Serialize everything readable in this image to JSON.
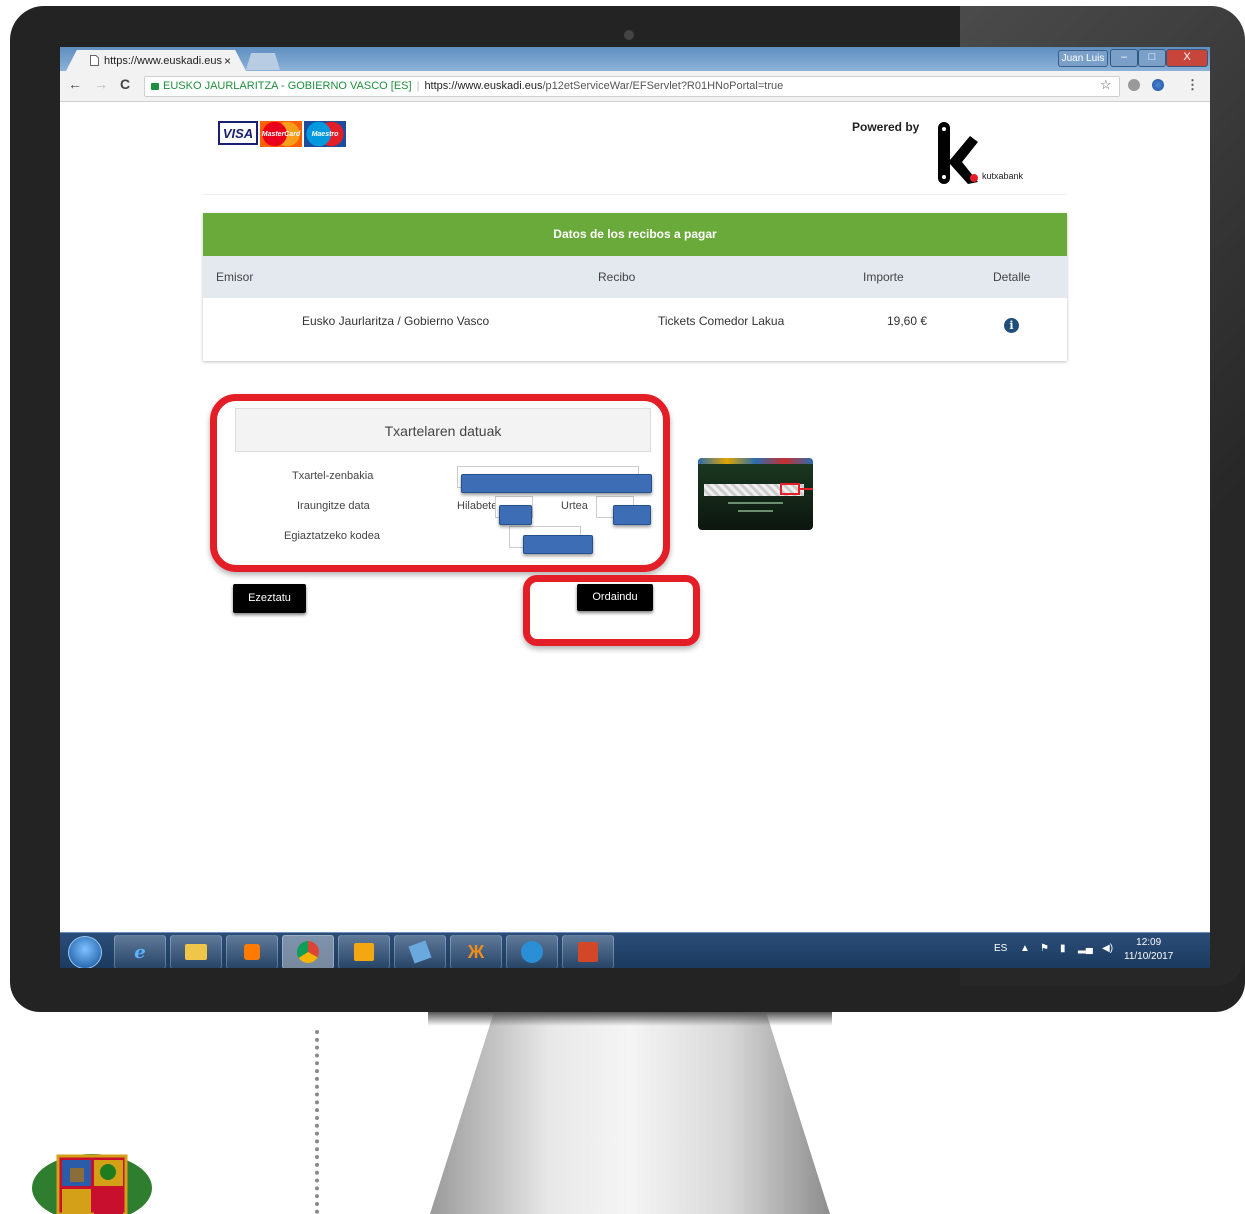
{
  "browser": {
    "tab_title": "https://www.euskadi.eus",
    "tab_close": "×",
    "window_user": "Juan Luis",
    "minimize": "–",
    "maximize": "□",
    "close": "X",
    "back": "←",
    "forward": "→",
    "reload": "C",
    "site_identity": "EUSKO JAURLARITZA - GOBIERNO VASCO [ES]",
    "url_host": "https://www.euskadi.eus",
    "url_path": "/p12etServiceWar/EFServlet?R01HNoPortal=true",
    "bookmark_star": "☆",
    "menu": "⋮"
  },
  "header": {
    "card_brands": [
      "VISA",
      "MasterCard",
      "Maestro"
    ],
    "powered_by": "Powered by",
    "bank_name": "kutxabank"
  },
  "receipts_table": {
    "title": "Datos de los recibos a pagar",
    "columns": [
      "Emisor",
      "Recibo",
      "Importe",
      "Detalle"
    ],
    "rows": [
      {
        "emisor": "Eusko Jaurlaritza / Gobierno Vasco",
        "recibo": "Tickets Comedor Lakua",
        "importe": "19,60 €",
        "detalle_icon": "info-icon"
      }
    ]
  },
  "card_form": {
    "title": "Txartelaren datuak",
    "card_number_label": "Txartel-zenbakia",
    "expiry_label": "Iraungitze data",
    "month_label": "Hilabetea",
    "year_label": "Urtea",
    "cvv_label": "Egiaztatzeko kodea"
  },
  "buttons": {
    "cancel": "Ezeztatu",
    "pay": "Ordaindu"
  },
  "taskbar": {
    "language": "ES",
    "time": "12:09",
    "date": "11/10/2017"
  },
  "colors": {
    "table_header": "#6aaa3a",
    "highlight": "#e41e26",
    "masked_fields": "#3d6eb5"
  }
}
